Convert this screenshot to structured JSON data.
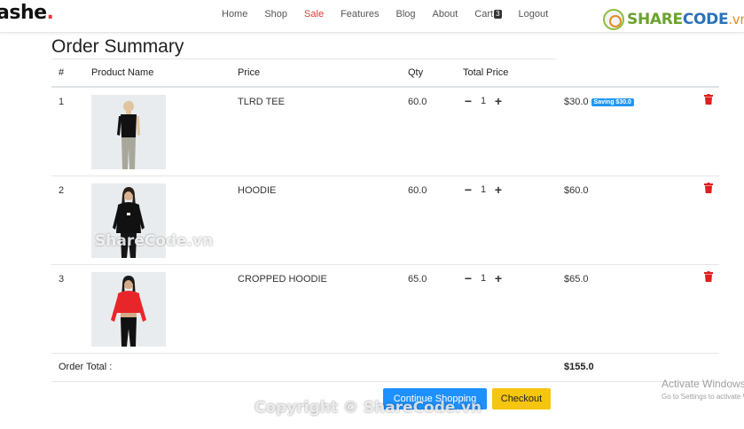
{
  "brand": {
    "name": "ashe",
    "dot": "."
  },
  "nav": {
    "items": [
      {
        "label": "Home"
      },
      {
        "label": "Shop"
      },
      {
        "label": "Sale"
      },
      {
        "label": "Features"
      },
      {
        "label": "Blog"
      },
      {
        "label": "About"
      },
      {
        "label": "Cart"
      },
      {
        "label": "Logout"
      }
    ],
    "active_color": "#e53637",
    "cart_count": "3"
  },
  "watermark": {
    "logo_share": "SHARE",
    "logo_code": "CODE",
    "logo_vn": ".vn",
    "mid_text": "ShareCode.vn",
    "bottom_text": "Copyright © ShareCode.vn"
  },
  "page": {
    "title": "Order Summary"
  },
  "table": {
    "headers": {
      "index": "#",
      "name": "Product Name",
      "price": "Price",
      "qty": "Qty",
      "total": "Total Price"
    },
    "rows": [
      {
        "index": "1",
        "name": "TLRD TEE",
        "price": "60.0",
        "qty": "1",
        "total": "$30.0",
        "badge": "Saving $30.0",
        "image": "tank-top-model"
      },
      {
        "index": "2",
        "name": "HOODIE",
        "price": "60.0",
        "qty": "1",
        "total": "$60.0",
        "badge": "",
        "image": "black-hoodie-model"
      },
      {
        "index": "3",
        "name": "CROPPED HOODIE",
        "price": "65.0",
        "qty": "1",
        "total": "$65.0",
        "badge": "",
        "image": "red-cropped-hoodie-model"
      }
    ],
    "total_label": "Order Total :",
    "total_value": "$155.0"
  },
  "buttons": {
    "continue_label": "Continue Shopping",
    "checkout_label": "Checkout"
  },
  "activation": {
    "title": "Activate Windows",
    "subtitle": "Go to Settings to activate Windows."
  },
  "colors": {
    "primary": "#1e90ff",
    "warning": "#f5c50f",
    "danger": "#e01e1e",
    "badge": "#2196f3"
  }
}
